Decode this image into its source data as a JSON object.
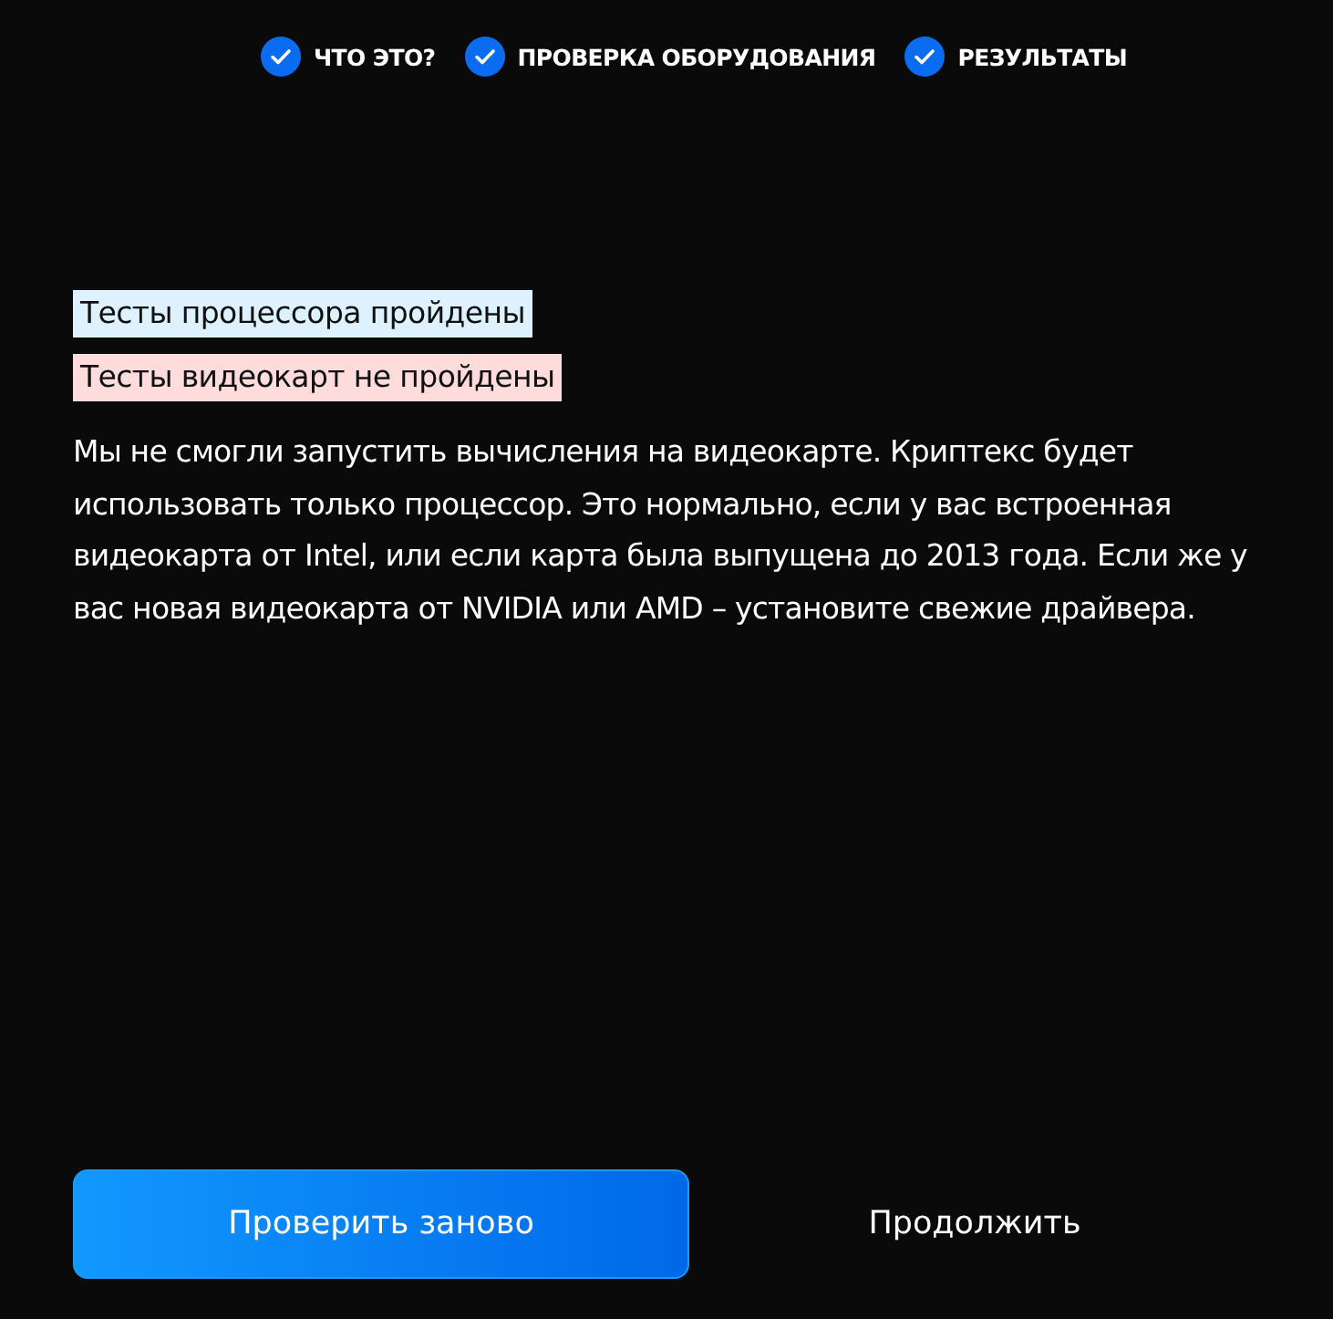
{
  "steps": [
    {
      "label": "ЧТО ЭТО?",
      "done": true
    },
    {
      "label": "ПРОВЕРКА ОБОРУДОВАНИЯ",
      "done": true
    },
    {
      "label": "РЕЗУЛЬТАТЫ",
      "done": true
    }
  ],
  "results": [
    {
      "text": "Тесты процессора пройдены",
      "passed": true
    },
    {
      "text": "Тесты видеокарт не пройдены",
      "passed": false
    }
  ],
  "message": "Мы не смогли запустить вычисления на видеокарте. Криптекс будет использовать только процессор. Это нормально, если у вас встроенная видеокарта от Intel, или если карта была выпущена до 2013 года. Если же у вас новая видеокарта от NVIDIA или AMD – установите свежие драйвера.",
  "buttons": [
    {
      "label": "Проверить заново",
      "kind": "primary"
    },
    {
      "label": "Продолжить",
      "kind": "secondary"
    }
  ]
}
